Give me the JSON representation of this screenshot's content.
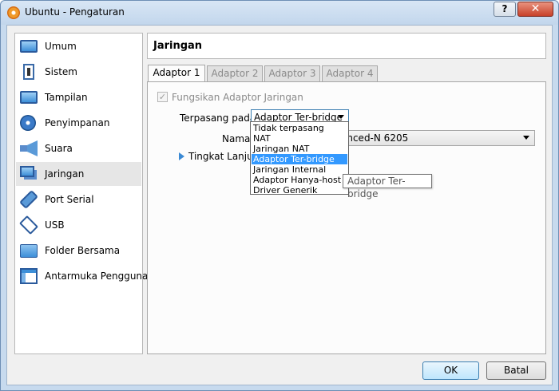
{
  "window": {
    "title": "Ubuntu - Pengaturan",
    "help_label": "?",
    "close_label": "✕"
  },
  "sidebar": {
    "items": [
      {
        "label": "Umum",
        "icon": "monitor-icon"
      },
      {
        "label": "Sistem",
        "icon": "chip-icon"
      },
      {
        "label": "Tampilan",
        "icon": "display-icon"
      },
      {
        "label": "Penyimpanan",
        "icon": "disk-icon"
      },
      {
        "label": "Suara",
        "icon": "speaker-icon"
      },
      {
        "label": "Jaringan",
        "icon": "network-icon",
        "selected": true
      },
      {
        "label": "Port Serial",
        "icon": "serial-port-icon"
      },
      {
        "label": "USB",
        "icon": "usb-icon"
      },
      {
        "label": "Folder Bersama",
        "icon": "folder-icon"
      },
      {
        "label": "Antarmuka Pengguna",
        "icon": "user-interface-icon"
      }
    ]
  },
  "main": {
    "title": "Jaringan",
    "tabs": [
      {
        "label": "Adaptor 1",
        "active": true
      },
      {
        "label": "Adaptor 2"
      },
      {
        "label": "Adaptor 3"
      },
      {
        "label": "Adaptor 4"
      }
    ],
    "enable_label": "Fungsikan Adaptor Jaringan",
    "attached_label": "Terpasang pada:",
    "attached_value": "Adaptor Ter-bridge",
    "name_label": "Nama:",
    "name_value": "anced-N 6205",
    "advanced_label": "Tingkat Lanjut"
  },
  "dropdown": {
    "options": [
      "Tidak terpasang",
      "NAT",
      "Jaringan NAT",
      "Adaptor Ter-bridge",
      "Jaringan Internal",
      "Adaptor Hanya-host",
      "Driver Generik"
    ],
    "highlighted_index": 3
  },
  "tooltip": "Adaptor Ter-bridge",
  "buttons": {
    "ok": "OK",
    "cancel": "Batal"
  },
  "colors": {
    "selection": "#3399ff",
    "titlebar": "#c7daee",
    "accent_arrow": "#3b8ad4"
  }
}
